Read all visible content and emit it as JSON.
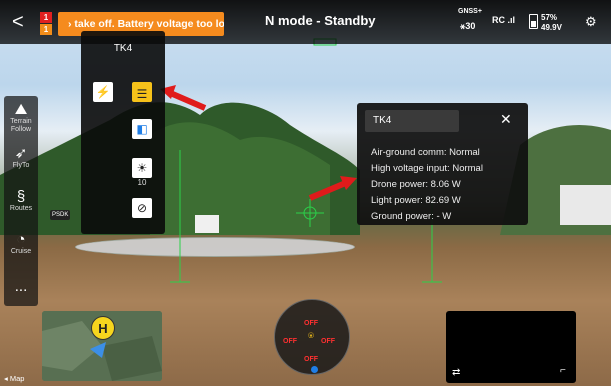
{
  "topbar": {
    "back_label": "<",
    "badge_red": "1",
    "badge_orange": "1",
    "warning": "› take off. Battery voltage too low ‹",
    "mode": "N mode - Standby",
    "gnss_label": "GNSS+",
    "gnss_count": "30",
    "rc_label": "RC",
    "battery_percent": "57%",
    "battery_voltage": "49.9V",
    "accent_colors": {
      "warning_orange": "#f58b1e",
      "badge_red": "#e02020",
      "hud_green": "#2bd14a"
    }
  },
  "sidebar": {
    "items": [
      {
        "label": "Terrain Follow",
        "icon": "terrain-icon"
      },
      {
        "label": "FlyTo",
        "icon": "flyto-icon"
      },
      {
        "label": "Routes",
        "icon": "routes-icon"
      },
      {
        "label": "Cruise",
        "icon": "cruise-icon"
      },
      {
        "label": "...",
        "icon": "more-icon"
      }
    ]
  },
  "psdk": "PSDK",
  "payload_menu": {
    "title": "TK4",
    "brightness_value": "10",
    "icons": [
      "lightning-icon",
      "spotlight-icon",
      "brightness-icon",
      "mute-icon"
    ]
  },
  "payload_panel": {
    "title": "TK4",
    "close": "✕",
    "lines": [
      "Air-ground comm: Normal",
      "High voltage input: Normal",
      "Drone power: 8.06 W",
      "Light power: 82.69 W",
      "Ground power: - W"
    ]
  },
  "hud": {
    "compass_offs": [
      "OFF",
      "OFF",
      "OFF",
      "OFF"
    ],
    "home_marker": "H",
    "map_label": "Map"
  }
}
